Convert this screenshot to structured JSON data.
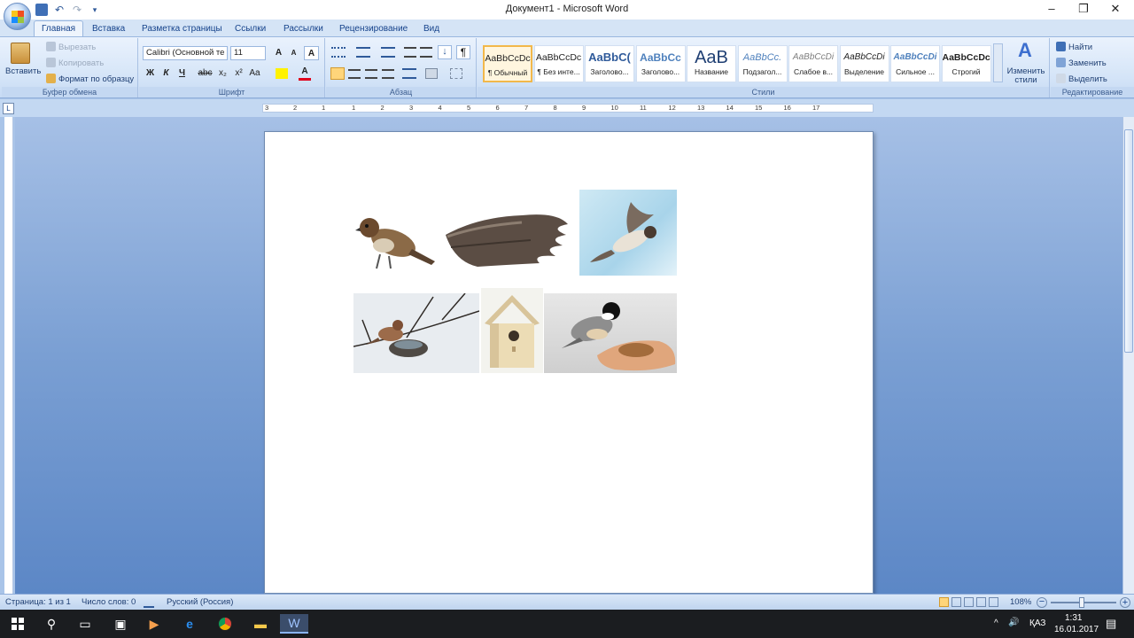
{
  "window": {
    "title": "Документ1 - Microsoft Word",
    "minimize": "–",
    "restore": "❐",
    "close": "✕"
  },
  "tabs": [
    "Главная",
    "Вставка",
    "Разметка страницы",
    "Ссылки",
    "Рассылки",
    "Рецензирование",
    "Вид"
  ],
  "clipboard": {
    "paste": "Вставить",
    "cut": "Вырезать",
    "copy": "Копировать",
    "format_painter": "Формат по образцу",
    "label": "Буфер обмена"
  },
  "font": {
    "name": "Calibri (Основной те",
    "size": "11",
    "label": "Шрифт",
    "bold": "Ж",
    "italic": "К",
    "underline": "Ч",
    "strike": "abc",
    "subscript": "x₂",
    "superscript": "x²",
    "change_case": "Aa",
    "grow": "A",
    "shrink": "A",
    "clear": "A"
  },
  "paragraph": {
    "label": "Абзац"
  },
  "styles": {
    "label": "Стили",
    "items": [
      {
        "sample": "AaBbCcDc",
        "name": "¶ Обычный"
      },
      {
        "sample": "AaBbCcDc",
        "name": "¶ Без инте..."
      },
      {
        "sample": "AaBbC(",
        "name": "Заголово..."
      },
      {
        "sample": "AaBbCc",
        "name": "Заголово..."
      },
      {
        "sample": "AaB",
        "name": "Название"
      },
      {
        "sample": "AaBbCc.",
        "name": "Подзагол..."
      },
      {
        "sample": "AaBbCcDi",
        "name": "Слабое в..."
      },
      {
        "sample": "AaBbCcDi",
        "name": "Выделение"
      },
      {
        "sample": "AaBbCcDi",
        "name": "Сильное ..."
      },
      {
        "sample": "AaBbCcDc",
        "name": "Строгий"
      }
    ],
    "change_styles": "Изменить стили"
  },
  "editing": {
    "label": "Редактирование",
    "find": "Найти",
    "replace": "Заменить",
    "select": "Выделить"
  },
  "ruler": {
    "marks": [
      "3",
      "2",
      "1",
      "1",
      "2",
      "3",
      "4",
      "5",
      "6",
      "7",
      "8",
      "9",
      "10",
      "11",
      "12",
      "13",
      "14",
      "15",
      "16",
      "17"
    ]
  },
  "document": {
    "images": [
      "sparrow-perched-icon",
      "bird-wing-icon",
      "flying-bird-photo-icon",
      "bird-on-nest-icon",
      "birdhouse-icon",
      "chickadee-on-hand-icon"
    ]
  },
  "status": {
    "page": "Страница: 1 из 1",
    "words": "Число слов: 0",
    "language": "Русский (Россия)",
    "zoom": "108%"
  },
  "taskbar": {
    "lang": "ҚАЗ",
    "time": "1:31",
    "date": "16.01.2017"
  }
}
